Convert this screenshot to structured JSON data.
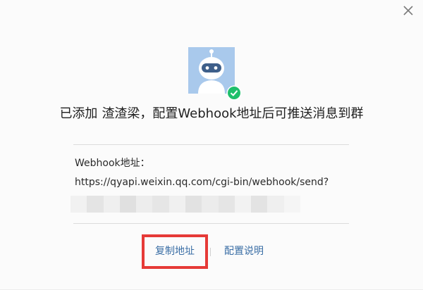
{
  "dialog": {
    "close_icon": "close-icon",
    "avatar_icon": "robot-icon",
    "status_icon": "check-circle-icon",
    "headline_part1": "已添加",
    "headline_part2": "渣渣梁，配置Webhook地址后可推送消息到群",
    "webhook_label": "Webhook地址：",
    "webhook_url": "https://qyapi.weixin.qq.com/cgi-bin/webhook/send?",
    "copy_label": "复制地址",
    "help_label": "配置说明"
  },
  "colors": {
    "link": "#3a6ea5",
    "highlight": "#e63a37",
    "success": "#1fbf6b",
    "avatar_bg": "#a9c9ec"
  }
}
